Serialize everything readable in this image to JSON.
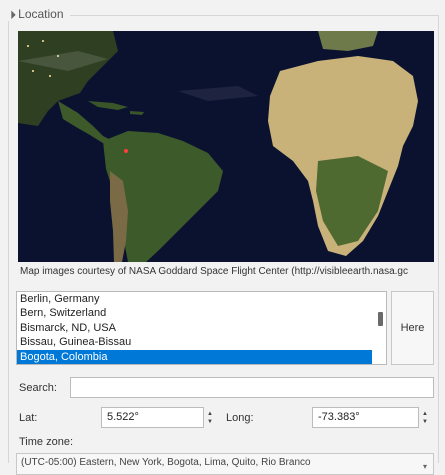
{
  "group": {
    "title": "Location"
  },
  "map": {
    "caption": "Map images courtesy of NASA Goddard Space Flight Center (http://visibleearth.nasa.gc"
  },
  "locations": {
    "items": [
      "Berlin, Germany",
      "Bern, Switzerland",
      "Bismarck, ND, USA",
      "Bissau, Guinea-Bissau",
      "Bogota, Colombia"
    ],
    "selected": "Bogota, Colombia"
  },
  "here_button": {
    "label": "Here"
  },
  "search": {
    "label": "Search:",
    "value": ""
  },
  "lat": {
    "label": "Lat:",
    "value": "5.522°"
  },
  "long": {
    "label": "Long:",
    "value": "-73.383°"
  },
  "timezone": {
    "label": "Time zone:",
    "value": "(UTC-05:00) Eastern, New York, Bogota, Lima, Quito, Rio Branco"
  },
  "colors": {
    "selection": "#0078d7",
    "ocean": "#0b1230",
    "land_green": "#3d5a2a",
    "land_desert": "#c8b27a"
  }
}
